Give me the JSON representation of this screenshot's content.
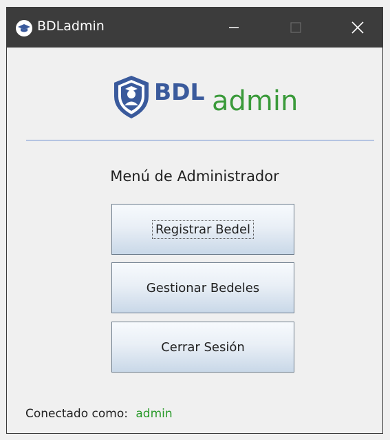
{
  "window": {
    "title": "BDLadmin",
    "icon": "graduation-cap-icon"
  },
  "titlebar_buttons": {
    "minimize_icon": "minimize-icon",
    "maximize_icon": "maximize-icon",
    "close_icon": "close-icon"
  },
  "logo": {
    "bdl": "BDL",
    "admin": "admin",
    "colors": {
      "blue": "#3a5a9c",
      "green": "#3a9a3a"
    }
  },
  "menu": {
    "title": "Menú de Administrador",
    "buttons": [
      "Registrar Bedel",
      "Gestionar Bedeles",
      "Cerrar Sesión"
    ]
  },
  "status": {
    "label": "Conectado como:",
    "user": "admin"
  }
}
